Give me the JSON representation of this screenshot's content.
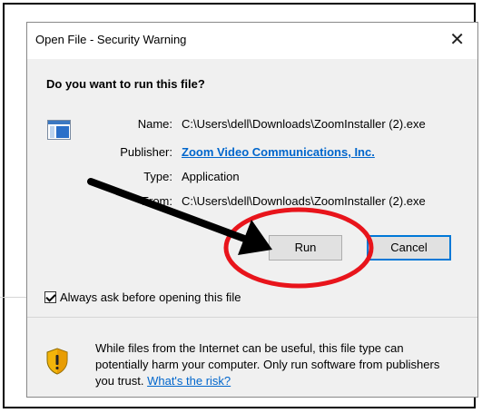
{
  "dialog": {
    "title": "Open File - Security Warning",
    "close_glyph": "✕",
    "question": "Do you want to run this file?",
    "file_icon": "application-window-icon",
    "fields": [
      {
        "label": "Name:",
        "value": "C:\\Users\\dell\\Downloads\\ZoomInstaller (2).exe",
        "is_link": false
      },
      {
        "label": "Publisher:",
        "value": "Zoom Video Communications, Inc.",
        "is_link": true
      },
      {
        "label": "Type:",
        "value": "Application",
        "is_link": false
      },
      {
        "label": "From:",
        "value": "C:\\Users\\dell\\Downloads\\ZoomInstaller (2).exe",
        "is_link": false
      }
    ],
    "buttons": {
      "run": "Run",
      "cancel": "Cancel"
    },
    "checkbox": {
      "label": "Always ask before opening this file",
      "checked": true
    },
    "warning": {
      "text": "While files from the Internet can be useful, this file type can potentially harm your computer. Only run software from publishers you trust.",
      "link": "What's the risk?"
    }
  },
  "annotations": {
    "arrow_color": "#000000",
    "circle_color": "#e8141b"
  },
  "colors": {
    "link": "#0066cc",
    "default_button_border": "#0078d7"
  }
}
